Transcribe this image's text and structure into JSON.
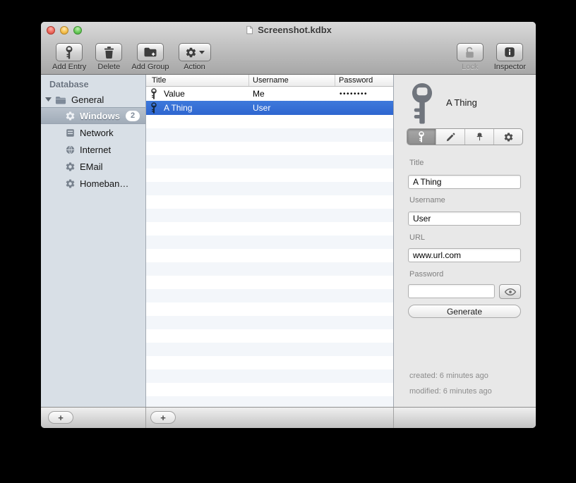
{
  "window": {
    "title": "Screenshot.kdbx"
  },
  "toolbar": {
    "add_entry": {
      "label": "Add Entry",
      "icon": "key-icon"
    },
    "delete": {
      "label": "Delete",
      "icon": "trash-icon"
    },
    "add_group": {
      "label": "Add Group",
      "icon": "folder-plus-icon"
    },
    "action": {
      "label": "Action",
      "icon": "gear-icon"
    },
    "lock": {
      "label": "Lock",
      "icon": "open-lock-icon",
      "disabled": true
    },
    "inspector": {
      "label": "Inspector",
      "icon": "info-icon"
    }
  },
  "sidebar": {
    "header": "Database",
    "root": {
      "label": "General",
      "icon": "folder-icon",
      "expanded": true
    },
    "items": [
      {
        "label": "Windows",
        "icon": "gear-icon",
        "badge": "2",
        "selected": true
      },
      {
        "label": "Network",
        "icon": "server-icon"
      },
      {
        "label": "Internet",
        "icon": "globe-icon"
      },
      {
        "label": "EMail",
        "icon": "gear-icon"
      },
      {
        "label": "Homeban…",
        "icon": "gear-icon"
      }
    ]
  },
  "table": {
    "columns": [
      "Title",
      "Username",
      "Password"
    ],
    "rows": [
      {
        "title": "Value",
        "username": "Me",
        "password_masked": "••••••••",
        "selected": false
      },
      {
        "title": "A Thing",
        "username": "User",
        "password_masked": "",
        "selected": true
      }
    ]
  },
  "inspector": {
    "entry_title": "A Thing",
    "tabs": [
      {
        "icon": "key-icon",
        "selected": true
      },
      {
        "icon": "pencil-icon"
      },
      {
        "icon": "pin-icon"
      },
      {
        "icon": "gear-icon"
      }
    ],
    "fields": [
      {
        "label": "Title",
        "value": "A Thing"
      },
      {
        "label": "Username",
        "value": "User"
      },
      {
        "label": "URL",
        "value": "www.url.com"
      },
      {
        "label": "Password",
        "value": ""
      }
    ],
    "eye_icon": "eye-icon",
    "generate_label": "Generate",
    "created": "created: 6 minutes ago",
    "modified": "modified: 6 minutes ago"
  },
  "bottom": {
    "add_group_label": "+",
    "add_entry_label": "+"
  },
  "colors": {
    "selection_blue": "#3571d8",
    "sidebar_selection": "#a9b4c0",
    "row_stripe": "#f3f6fa",
    "chrome_top": "#dadada",
    "chrome_bottom": "#a7a7a7",
    "sidebar_bg": "#d8dfe6"
  }
}
